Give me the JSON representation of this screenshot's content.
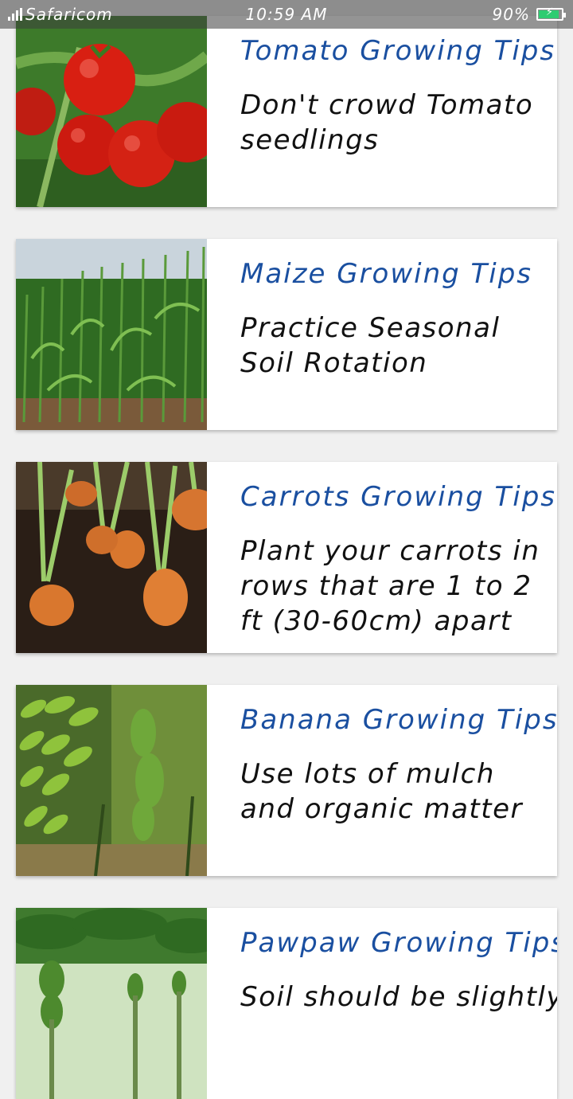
{
  "status_bar": {
    "carrier": "Safaricom",
    "time": "10:59 AM",
    "battery": "90%",
    "battery_level": 0.9,
    "battery_color": "#2ecc71"
  },
  "colors": {
    "title": "#1a4fa0",
    "tip": "#111111"
  },
  "tips": [
    {
      "title": "Tomato Growing Tips",
      "tip": "Don't crowd Tomato seedlings",
      "image": "tomato-image"
    },
    {
      "title": "Maize Growing Tips",
      "tip": "Practice Seasonal Soil Rotation",
      "image": "maize-image"
    },
    {
      "title": "Carrots Growing Tips",
      "tip": "Plant your carrots in rows that are 1 to 2 ft (30-60cm) apart",
      "image": "carrots-image"
    },
    {
      "title": "Banana Growing Tips",
      "tip": "Use lots of mulch and organic matter",
      "image": "banana-image"
    },
    {
      "title": "Pawpaw Growing Tips",
      "tip": "Soil should be slightly",
      "image": "pawpaw-image"
    }
  ]
}
